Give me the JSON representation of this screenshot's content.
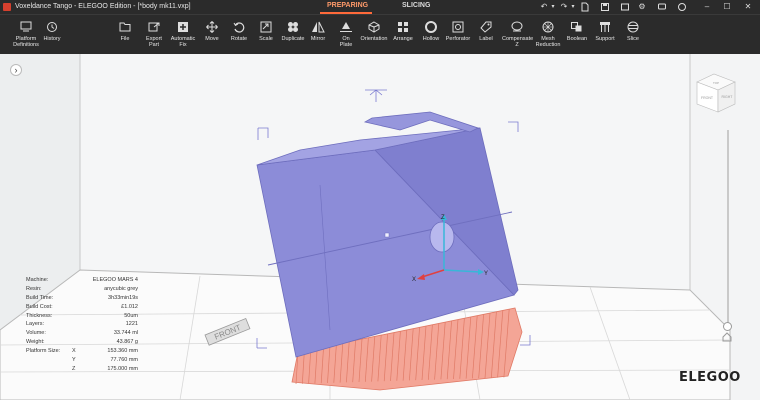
{
  "window": {
    "title": "Voxeldance Tango - ELEGOO Edition - [*body mk11.vxp]"
  },
  "mode_tabs": [
    {
      "label": "PREPARING",
      "active": true
    },
    {
      "label": "SLICING",
      "active": false
    }
  ],
  "left_tools": [
    {
      "label": "Platform\nDefinitions",
      "icon": "platform-icon"
    },
    {
      "label": "History",
      "icon": "history-icon"
    }
  ],
  "tools": [
    {
      "label": "File",
      "icon": "folder-icon"
    },
    {
      "label": "Export\nPart",
      "icon": "export-icon"
    },
    {
      "label": "Automatic\nFix",
      "icon": "plus-box-icon"
    },
    {
      "label": "Move",
      "icon": "move-icon"
    },
    {
      "label": "Rotate",
      "icon": "rotate-icon"
    },
    {
      "label": "Scale",
      "icon": "scale-icon"
    },
    {
      "label": "Duplicate",
      "icon": "duplicate-icon"
    },
    {
      "label": "Mirror",
      "icon": "mirror-icon"
    },
    {
      "label": "On\nPlate",
      "icon": "on-plate-icon"
    },
    {
      "label": "Orientation",
      "icon": "orientation-icon"
    },
    {
      "label": "Arrange",
      "icon": "arrange-icon"
    },
    {
      "label": "Hollow",
      "icon": "hollow-icon"
    },
    {
      "label": "Perforator",
      "icon": "perforator-icon"
    },
    {
      "label": "Label",
      "icon": "label-icon"
    },
    {
      "label": "Compensate\nZ",
      "icon": "compensate-icon"
    },
    {
      "label": "Mesh\nReduction",
      "icon": "mesh-icon"
    },
    {
      "label": "Boolean",
      "icon": "boolean-icon"
    },
    {
      "label": "Support",
      "icon": "support-icon"
    },
    {
      "label": "Slice",
      "icon": "slice-icon"
    }
  ],
  "info": [
    {
      "label": "Machine:",
      "axis": "",
      "value": "ELEGOO MARS 4"
    },
    {
      "label": "Resin:",
      "axis": "",
      "value": "anycubic grey"
    },
    {
      "label": "Build Time:",
      "axis": "",
      "value": "3h33min19s"
    },
    {
      "label": "Build Cost:",
      "axis": "",
      "value": "£1.012"
    },
    {
      "label": "Thickness:",
      "axis": "",
      "value": "50um"
    },
    {
      "label": "Layers:",
      "axis": "",
      "value": "1221"
    },
    {
      "label": "Volume:",
      "axis": "",
      "value": "33.744 ml"
    },
    {
      "label": "Weight:",
      "axis": "",
      "value": "43.867 g"
    },
    {
      "label": "Platform Size:",
      "axis": "X",
      "value": "153.360 mm"
    },
    {
      "label": "",
      "axis": "Y",
      "value": "77.760 mm"
    },
    {
      "label": "",
      "axis": "Z",
      "value": "175.000 mm"
    }
  ],
  "viewport": {
    "front_label": "FRONT",
    "cube_faces": {
      "top": "TOP",
      "front": "FRONT",
      "side": "RIGHT"
    },
    "axes": {
      "x": "X",
      "y": "Y",
      "z": "Z"
    }
  },
  "brand": {
    "logo": "ELEGOO"
  },
  "colors": {
    "accent": "#ff6a3a",
    "model": "#8f8fd6",
    "supports": "#f28a78",
    "toolbar": "#2b2b2b"
  }
}
